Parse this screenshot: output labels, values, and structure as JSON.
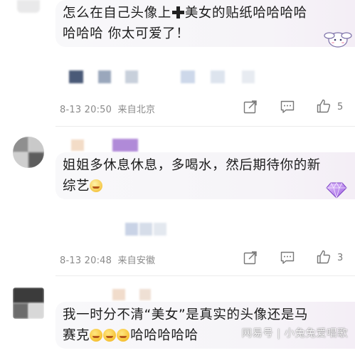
{
  "comments": [
    {
      "text_line1_part1": "怎么在自己头像上",
      "text_line1_part2": "美女的贴纸哈哈哈哈",
      "text_line2": "哈哈哈 你太可爱了！",
      "timestamp": "8-13 20:50",
      "location": "来自北京",
      "like_count": "5"
    },
    {
      "text_line1": "姐姐多休息休息，多喝水，然后期待你的新",
      "text_line2": "综艺",
      "timestamp": "8-13 20:48",
      "location": "来自安徽",
      "like_count": "3"
    },
    {
      "text_line1": "我一时分不清“美女”是真实的头像还是马",
      "text_line2": "赛克",
      "text_line2_suffix": "哈哈哈哈哈"
    }
  ],
  "watermark": "网易号 | 小兔兔爱唱歌",
  "icons": {
    "share": "share-icon",
    "comment": "comment-icon",
    "like": "thumbs-up-icon",
    "sticker": "cinnamoroll-sticker-icon",
    "badge": "diamond-badge-icon"
  }
}
